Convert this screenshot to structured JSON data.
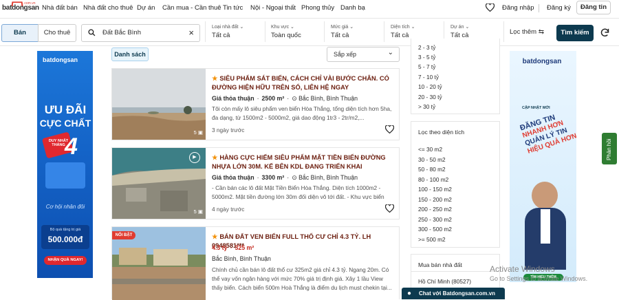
{
  "header": {
    "logo": {
      "brand": "batdongsan",
      "suffix": ".com.vn"
    },
    "nav": [
      "Nhà đất bán",
      "Nhà đất cho thuê",
      "Dự án",
      "Cần mua - Cần thuê",
      "Tin tức",
      "Nội - Ngoại thất",
      "Phong thủy",
      "Danh bạ"
    ],
    "login": "Đăng nhập",
    "register": "Đăng ký",
    "post": "Đăng tin"
  },
  "search": {
    "tab_sell": "Bán",
    "tab_rent": "Cho thuê",
    "query": "Đất Bắc Bình",
    "filters": [
      {
        "label": "Loại nhà đất",
        "value": "Tất cả"
      },
      {
        "label": "Khu vực",
        "value": "Toàn quốc"
      },
      {
        "label": "Mức giá",
        "value": "Tất cả"
      },
      {
        "label": "Diện tích",
        "value": "Tất cả"
      },
      {
        "label": "Dự án",
        "value": "Tất cả"
      }
    ],
    "more_filters": "Lọc thêm",
    "search_button": "Tìm kiếm"
  },
  "list": {
    "view_label": "Danh sách",
    "sort_label": "Sắp xếp"
  },
  "listings": [
    {
      "title": "SIÊU PHẨM SÁT BIỂN, CÁCH CHỈ VÀI BƯỚC CHÂN. CÓ ĐƯỜNG HIỆN HỮU TRÊN SỔ, LIÊN HỆ NGAY",
      "price": "Giá thỏa thuận",
      "area": "2500 m²",
      "location": "Bắc Bình, Bình Thuận",
      "desc": "Tôi còn mấy lô siêu phẩm ven biển Hòa Thắng, tổng diện tích hơn 5ha, đa dạng, từ 1500m2 - 5000m2, giá dao động 1tr3 - 2tr/m2,...",
      "time": "3 ngày trước",
      "images": "5"
    },
    {
      "title": "HÀNG CỰC HIẾM SIÊU PHẨM MẶT TIỀN BIỂN ĐƯỜNG NHỰA LỚN 30M. KẾ BÊN KDL ĐANG TRIỂN KHAI",
      "price": "Giá thỏa thuận",
      "area": "3300 m²",
      "location": "Bắc Bình, Bình Thuận",
      "desc": "- Cần bán các lô đất Mặt Tiền Biển Hòa Thắng. Diện tích 1000m2 - 5000m2. Mặt tiền đường lớn 30m đối diện vô tới đất. - Khu vực biển đẹ...",
      "time": "4 ngày trước",
      "images": "5"
    },
    {
      "badge": "NỔI BẬT",
      "title": "BÁN ĐẤT VEN BIỂN FULL THỔ CƯ CHỈ 4.3 TỶ. LH 0948581***",
      "price": "4.3 tỷ",
      "area": "325 m²",
      "location": "Bắc Bình, Bình Thuận",
      "desc": "Chính chủ cần bán lô đất thổ cư 325m2 giá chỉ 4.3 tỷ. Ngang 20m. Có thể vay vốn ngân hàng với mức 70% giá trị định giá. Xây 1 lầu View thấy biển. Cách biển 500m Hoà Thắng là điểm du lịch must chekin tại..."
    }
  ],
  "price_filter": {
    "items": [
      "2 - 3 tỷ",
      "3 - 5 tỷ",
      "5 - 7 tỷ",
      "7 - 10 tỷ",
      "10 - 20 tỷ",
      "20 - 30 tỷ",
      "> 30 tỷ"
    ]
  },
  "area_filter": {
    "title": "Lọc theo diện tích",
    "items": [
      "<= 30 m2",
      "30 - 50 m2",
      "50 - 80 m2",
      "80 - 100 m2",
      "100 - 150 m2",
      "150 - 200 m2",
      "200 - 250 m2",
      "250 - 300 m2",
      "300 - 500 m2",
      ">= 500 m2"
    ]
  },
  "city_box": {
    "title": "Mua bán nhà đất",
    "items": [
      "Hồ Chí Minh (80527)"
    ]
  },
  "ad_left": {
    "line1": "ƯU ĐÃI",
    "line2": "CỰC CHẤT",
    "ribbon": "DUY NHẤT THÁNG",
    "num": "4",
    "script": "Cơ hội nhân đôi",
    "gift_label": "Bộ quà tặng trị giá",
    "gift_value": "500.000đ",
    "cta": "NHẬN QUÀ NGAY!"
  },
  "ad_right": {
    "tag": "CẬP NHẬT MỚI",
    "line1": "ĐĂNG TIN",
    "line2": "NHANH HƠN",
    "line3": "QUẢN LÝ TIN",
    "line4": "HIỆU QUẢ HƠN",
    "cta": "TÌM HIỂU THÊM"
  },
  "chat": "Chat với Batdongsan.com.vn",
  "feedback": "Phản hồi",
  "watermark": {
    "line1": "Activate Windows",
    "line2": "Go to Settings to activate Windows."
  },
  "colors": {
    "brand_red": "#e03c31",
    "navy": "#0d3a4f",
    "title_red": "#6b1d0e",
    "star": "#f2920c"
  }
}
